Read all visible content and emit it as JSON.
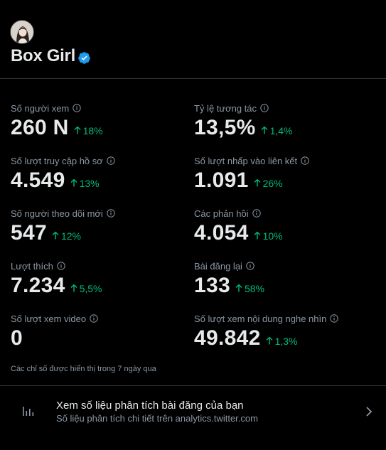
{
  "profile": {
    "display_name": "Box Girl",
    "verified": true
  },
  "metrics": {
    "left": [
      {
        "label": "Số người xem",
        "value": "260 N",
        "delta": "18%"
      },
      {
        "label": "Số lượt truy cập hồ sơ",
        "value": "4.549",
        "delta": "13%"
      },
      {
        "label": "Số người theo dõi mới",
        "value": "547",
        "delta": "12%"
      },
      {
        "label": "Lượt thích",
        "value": "7.234",
        "delta": "5,5%"
      },
      {
        "label": "Số lượt xem video",
        "value": "0",
        "delta": ""
      }
    ],
    "right": [
      {
        "label": "Tỷ lệ tương tác",
        "value": "13,5%",
        "delta": "1,4%"
      },
      {
        "label": "Số lượt nhấp vào liên kết",
        "value": "1.091",
        "delta": "26%"
      },
      {
        "label": "Các phản hồi",
        "value": "4.054",
        "delta": "10%"
      },
      {
        "label": "Bài đăng lại",
        "value": "133",
        "delta": "58%"
      },
      {
        "label": "Số lượt xem nội dung nghe nhìn",
        "value": "49.842",
        "delta": "1,3%"
      }
    ]
  },
  "footnote": "Các chỉ số được hiển thị trong 7 ngày qua",
  "analytics_link": {
    "title": "Xem số liệu phân tích bài đăng của bạn",
    "subtitle": "Số liệu phân tích chi tiết trên analytics.twitter.com",
    "icon": "bar-chart-icon"
  },
  "colors": {
    "background": "#000000",
    "primary_text": "#e7e9ea",
    "secondary_text": "#8b98a5",
    "positive_delta": "#00ba7c",
    "verified_badge": "#1d9bf0",
    "divider": "#2f3336"
  }
}
